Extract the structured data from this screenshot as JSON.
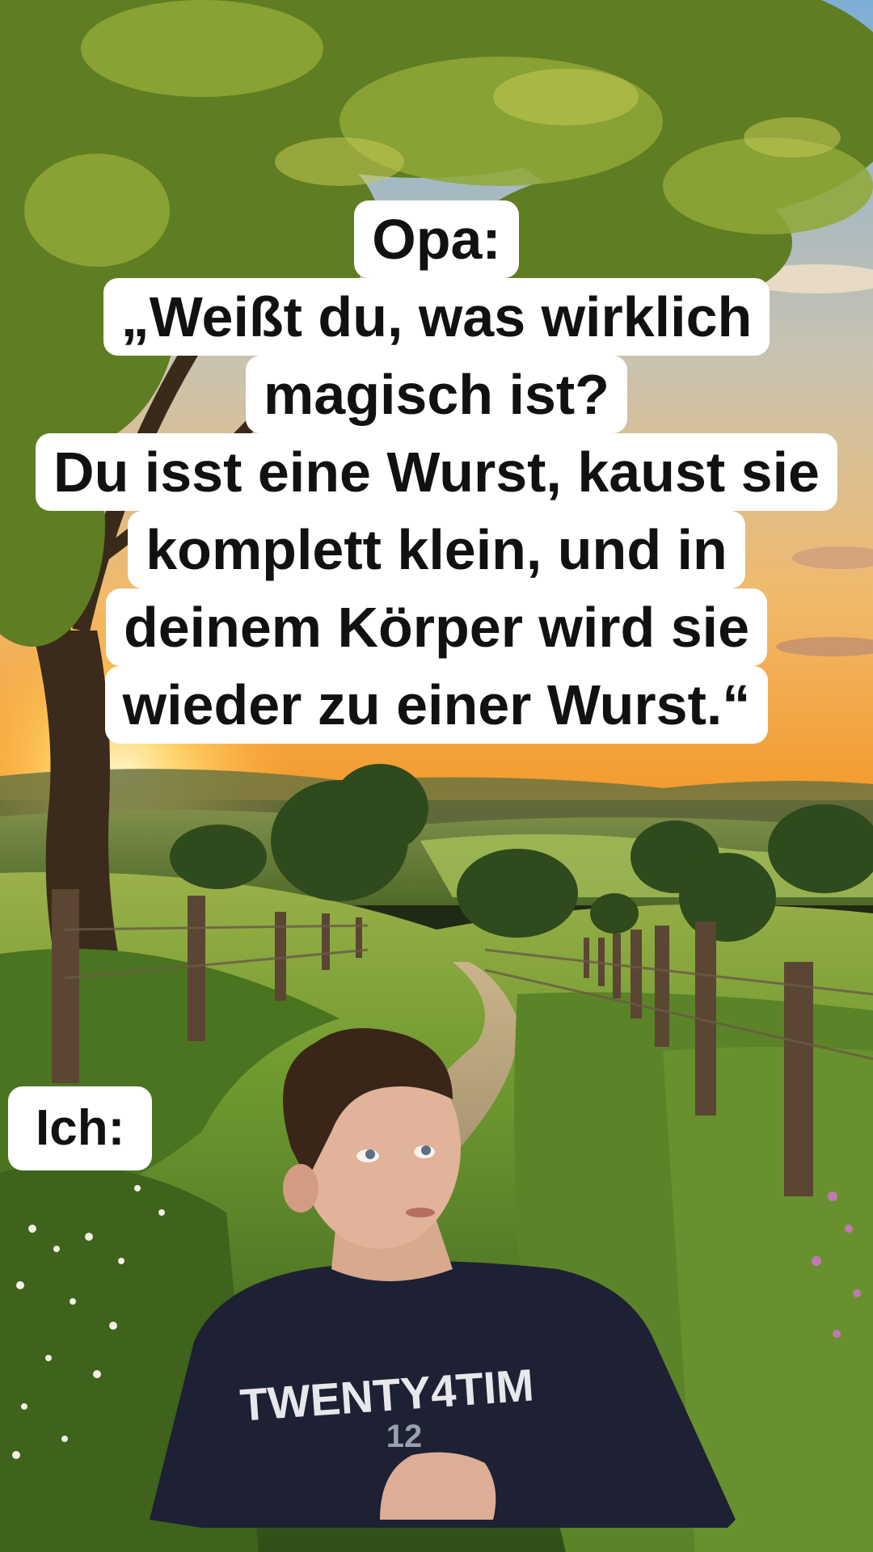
{
  "colors": {
    "sky_top": "#8bb6d8",
    "sunset": "#f6b64a",
    "grass": "#5b8a2a",
    "caption_bg": "#ffffff",
    "caption_text": "#111111",
    "shirt": "#1d2133"
  },
  "caption": {
    "lines": [
      "Opa:",
      "„Weißt du, was wirklich",
      "magisch ist?",
      "Du isst eine Wurst, kaust sie",
      "komplett klein, und in",
      "deinem Körper wird sie",
      "wieder zu einer Wurst.“"
    ]
  },
  "reaction": {
    "label": "Ich:"
  },
  "person": {
    "shirt_text_line1": "TWENTY4TIM",
    "shirt_text_line2": "12"
  }
}
